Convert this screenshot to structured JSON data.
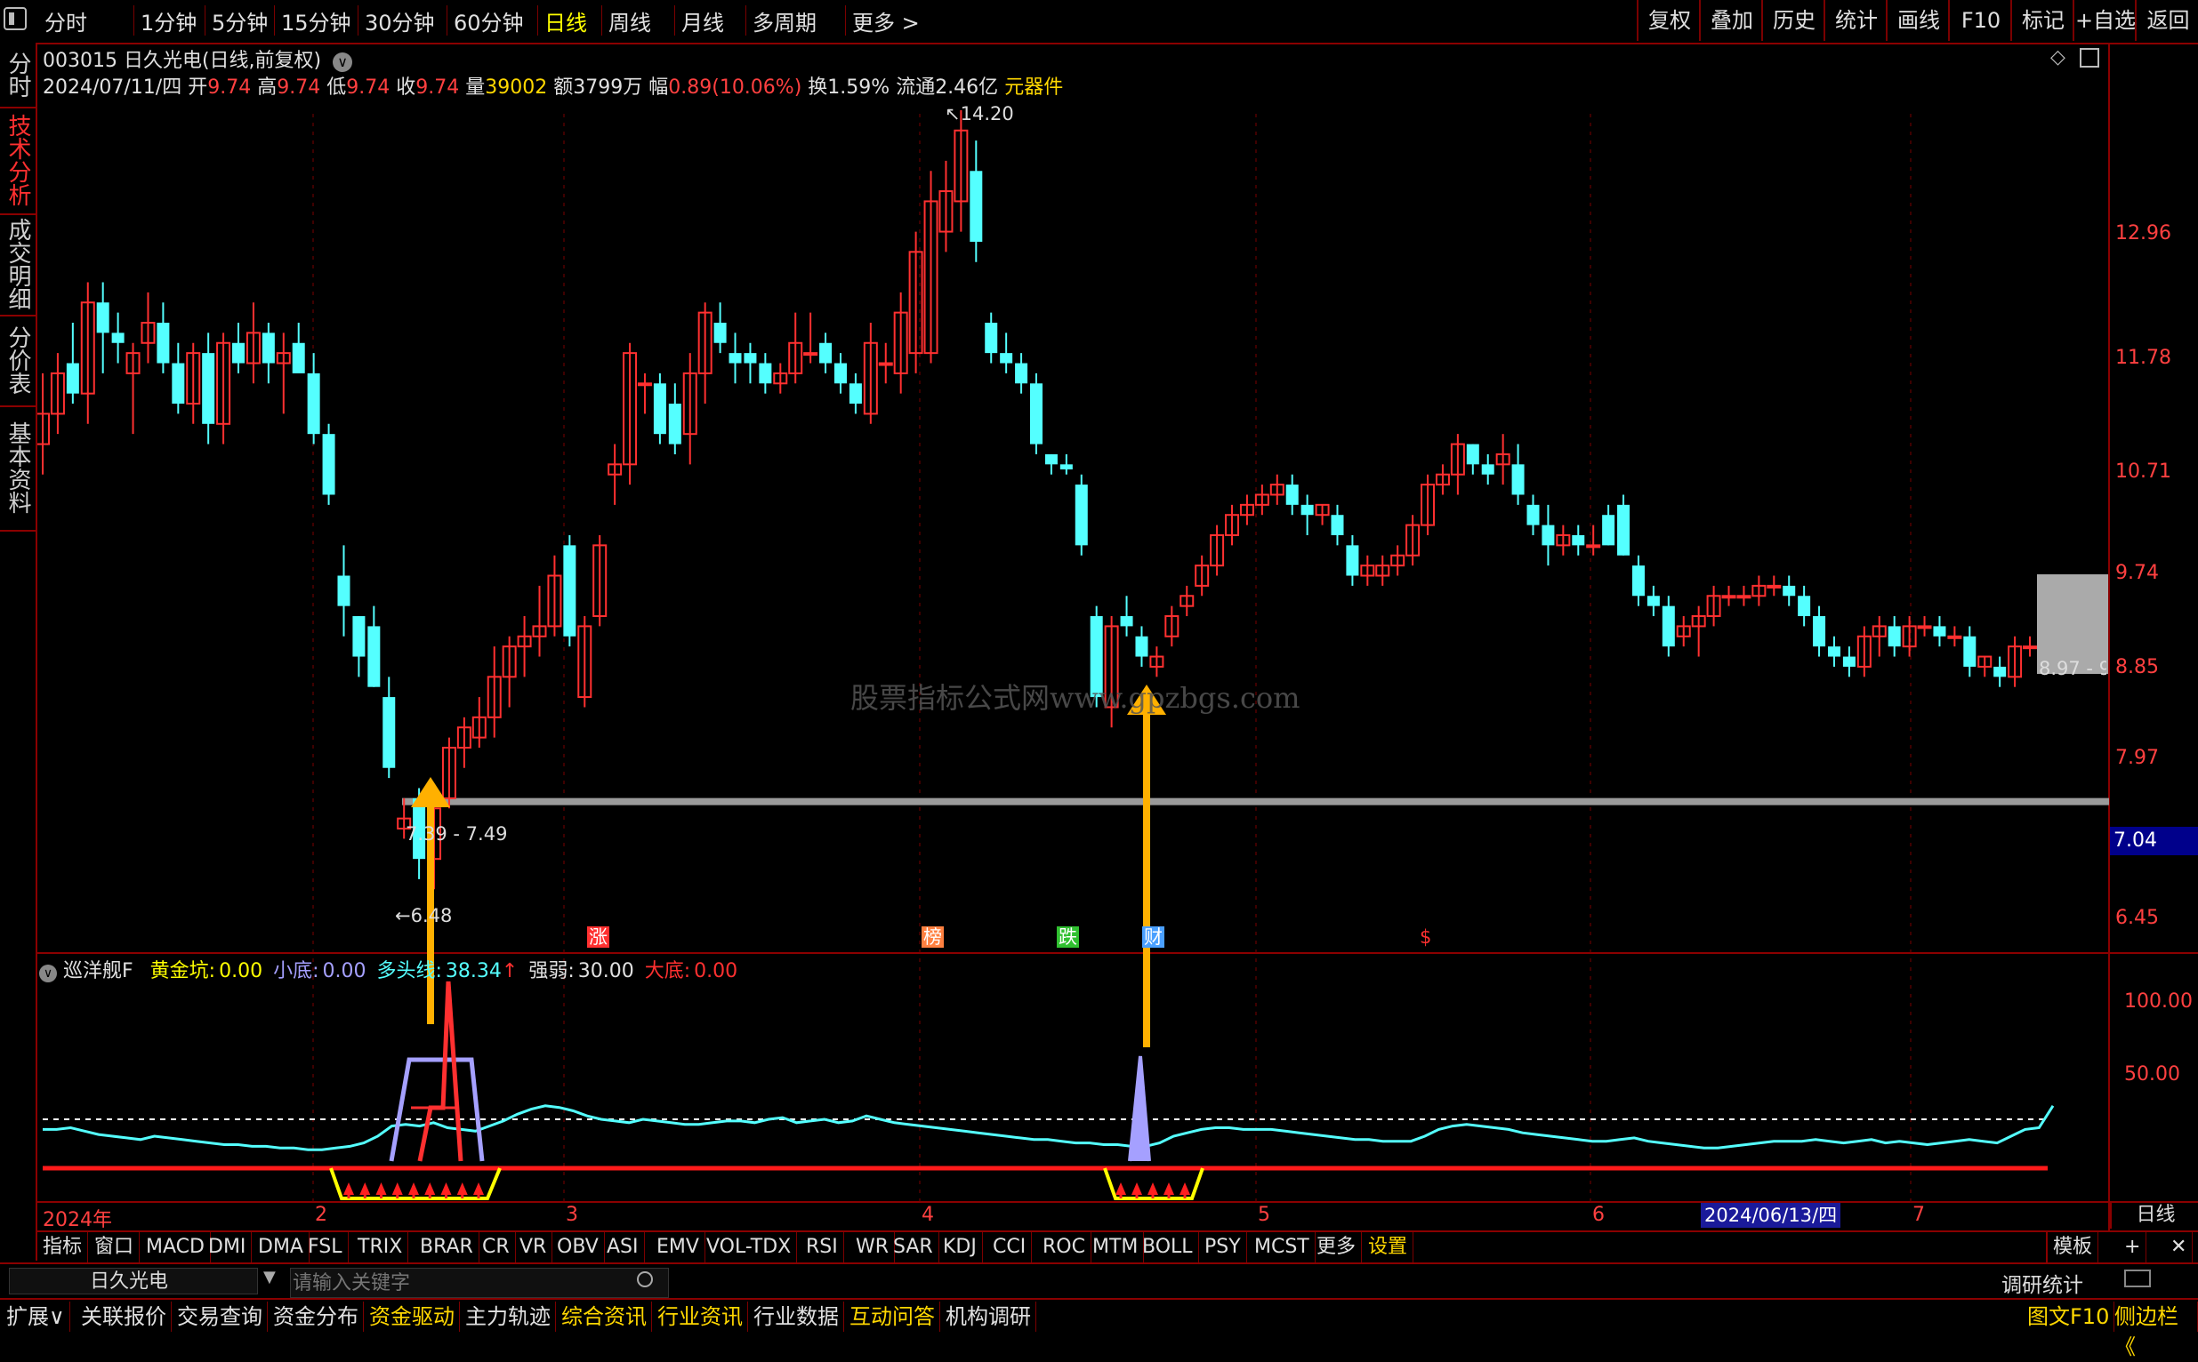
{
  "toolbar": {
    "periods": [
      "分时",
      "1分钟",
      "5分钟",
      "15分钟",
      "30分钟",
      "60分钟",
      "日线",
      "周线",
      "月线",
      "多周期",
      "更多 >"
    ],
    "active_period": "日线",
    "right_buttons": [
      "复权",
      "叠加",
      "历史",
      "统计",
      "画线",
      "F10",
      "标记",
      "+自选",
      "返回"
    ]
  },
  "left_tabs": [
    "分时走势",
    "技术分析",
    "成交明细",
    "分价表",
    "基本资料"
  ],
  "stock": {
    "header": "003015 日久光电(日线,前复权)",
    "date": "2024/07/11/四",
    "open_label": "开",
    "open": "9.74",
    "high_label": "高",
    "high": "9.74",
    "low_label": "低",
    "low": "9.74",
    "close_label": "收",
    "close": "9.74",
    "vol_label": "量",
    "vol": "39002",
    "amount": "额3799万",
    "change_label": "幅",
    "change": "0.89(10.06%)",
    "turnover": "换1.59%",
    "float_cap": "流通2.46亿",
    "sector": "元器件"
  },
  "price_axis": [
    "12.96",
    "11.78",
    "10.71",
    "9.74",
    "8.85",
    "7.97",
    "6.45"
  ],
  "price_tag": "7.04",
  "annotations": {
    "high_mark": "14.20",
    "low_mark": "6.48",
    "range_label": "7.39 - 7.49",
    "right_range_label": "8.97 - 9",
    "watermark": "股票指标公式网www.gpzbgs.com",
    "events": [
      "涨",
      "榜",
      "跌",
      "财",
      "$"
    ]
  },
  "indicator": {
    "name": "巡洋舰F",
    "fields": [
      {
        "label": "黄金坑:",
        "value": "0.00",
        "color": "#ffff00"
      },
      {
        "label": "小底:",
        "value": "0.00",
        "color": "#a5a0ff"
      },
      {
        "label": "多头线:",
        "value": "38.34",
        "color": "#5ff"
      },
      {
        "label": "强弱:",
        "value": "30.00",
        "color": "#e0e0e0"
      },
      {
        "label": "大底:",
        "value": "0.00",
        "color": "#ff3030"
      }
    ],
    "up_arrow": "↑",
    "axis": [
      "100.00",
      "50.00"
    ]
  },
  "time_axis": {
    "labels": [
      "2024年",
      "2",
      "3",
      "4",
      "5",
      "6",
      "7"
    ],
    "highlight": "2024/06/13/四",
    "period_label": "日线"
  },
  "indicator_tabs": [
    "指标",
    "窗口",
    "MACD",
    "DMI",
    "DMA",
    "FSL",
    "TRIX",
    "BRAR",
    "CR",
    "VR",
    "OBV",
    "ASI",
    "EMV",
    "VOL-TDX",
    "RSI",
    "WR",
    "SAR",
    "KDJ",
    "CCI",
    "ROC",
    "MTM",
    "BOLL",
    "PSY",
    "MCST",
    "更多",
    "设置"
  ],
  "template_button": "模板",
  "search": {
    "stock_name": "日久光电",
    "placeholder": "请输入关键字",
    "stats": "调研统计"
  },
  "bottom_tabs": [
    {
      "label": "扩展∨",
      "color": "#e0e0e0"
    },
    {
      "label": "关联报价",
      "color": "#e0e0e0"
    },
    {
      "label": "交易查询",
      "color": "#e0e0e0"
    },
    {
      "label": "资金分布",
      "color": "#e0e0e0"
    },
    {
      "label": "资金驱动",
      "color": "#ffd700"
    },
    {
      "label": "主力轨迹",
      "color": "#e0e0e0"
    },
    {
      "label": "综合资讯",
      "color": "#ffd700"
    },
    {
      "label": "行业资讯",
      "color": "#ffd700"
    },
    {
      "label": "行业数据",
      "color": "#e0e0e0"
    },
    {
      "label": "互动问答",
      "color": "#ffd700"
    },
    {
      "label": "机构调研",
      "color": "#e0e0e0"
    }
  ],
  "bottom_right": [
    "图文F10",
    "侧边栏《"
  ],
  "candles": [
    {
      "o": 10.9,
      "h": 11.6,
      "l": 10.6,
      "c": 11.2
    },
    {
      "o": 11.2,
      "h": 11.8,
      "l": 11.0,
      "c": 11.6
    },
    {
      "o": 11.7,
      "h": 12.1,
      "l": 11.3,
      "c": 11.4
    },
    {
      "o": 11.4,
      "h": 12.5,
      "l": 11.1,
      "c": 12.3
    },
    {
      "o": 12.3,
      "h": 12.5,
      "l": 11.6,
      "c": 12.0
    },
    {
      "o": 12.0,
      "h": 12.2,
      "l": 11.7,
      "c": 11.9
    },
    {
      "o": 11.6,
      "h": 11.9,
      "l": 11.0,
      "c": 11.8
    },
    {
      "o": 11.9,
      "h": 12.4,
      "l": 11.7,
      "c": 12.1
    },
    {
      "o": 12.1,
      "h": 12.3,
      "l": 11.6,
      "c": 11.7
    },
    {
      "o": 11.7,
      "h": 11.9,
      "l": 11.2,
      "c": 11.3
    },
    {
      "o": 11.3,
      "h": 11.9,
      "l": 11.1,
      "c": 11.8
    },
    {
      "o": 11.8,
      "h": 12.0,
      "l": 10.9,
      "c": 11.1
    },
    {
      "o": 11.1,
      "h": 12.0,
      "l": 10.9,
      "c": 11.9
    },
    {
      "o": 11.9,
      "h": 12.1,
      "l": 11.6,
      "c": 11.7
    },
    {
      "o": 11.7,
      "h": 12.3,
      "l": 11.5,
      "c": 12.0
    },
    {
      "o": 12.0,
      "h": 12.1,
      "l": 11.5,
      "c": 11.7
    },
    {
      "o": 11.7,
      "h": 12.0,
      "l": 11.2,
      "c": 11.8
    },
    {
      "o": 11.9,
      "h": 12.1,
      "l": 11.7,
      "c": 11.6
    },
    {
      "o": 11.6,
      "h": 11.8,
      "l": 10.9,
      "c": 11.0
    },
    {
      "o": 11.0,
      "h": 11.1,
      "l": 10.3,
      "c": 10.4
    },
    {
      "o": 9.6,
      "h": 9.9,
      "l": 9.0,
      "c": 9.3
    },
    {
      "o": 9.2,
      "h": 9.2,
      "l": 8.6,
      "c": 8.8
    },
    {
      "o": 9.1,
      "h": 9.3,
      "l": 8.5,
      "c": 8.5
    },
    {
      "o": 8.4,
      "h": 8.6,
      "l": 7.6,
      "c": 7.7
    },
    {
      "o": 7.1,
      "h": 7.4,
      "l": 7.0,
      "c": 7.2
    },
    {
      "o": 7.4,
      "h": 7.5,
      "l": 6.6,
      "c": 6.8
    },
    {
      "o": 6.8,
      "h": 7.4,
      "l": 6.5,
      "c": 7.3
    },
    {
      "o": 7.4,
      "h": 8.0,
      "l": 7.3,
      "c": 7.9
    },
    {
      "o": 7.9,
      "h": 8.2,
      "l": 7.7,
      "c": 8.1
    },
    {
      "o": 8.0,
      "h": 8.4,
      "l": 7.9,
      "c": 8.2
    },
    {
      "o": 8.2,
      "h": 8.9,
      "l": 8.0,
      "c": 8.6
    },
    {
      "o": 8.6,
      "h": 9.0,
      "l": 8.3,
      "c": 8.9
    },
    {
      "o": 8.9,
      "h": 9.2,
      "l": 8.6,
      "c": 9.0
    },
    {
      "o": 9.0,
      "h": 9.5,
      "l": 8.8,
      "c": 9.1
    },
    {
      "o": 9.1,
      "h": 9.8,
      "l": 9.0,
      "c": 9.6
    },
    {
      "o": 9.9,
      "h": 10.0,
      "l": 8.9,
      "c": 9.0
    },
    {
      "o": 8.4,
      "h": 9.2,
      "l": 8.3,
      "c": 9.1
    },
    {
      "o": 9.2,
      "h": 10.0,
      "l": 9.1,
      "c": 9.9
    },
    {
      "o": 10.6,
      "h": 10.9,
      "l": 10.3,
      "c": 10.7
    },
    {
      "o": 10.7,
      "h": 11.9,
      "l": 10.5,
      "c": 11.8
    },
    {
      "o": 11.5,
      "h": 11.6,
      "l": 11.2,
      "c": 11.5
    },
    {
      "o": 11.5,
      "h": 11.6,
      "l": 10.9,
      "c": 11.0
    },
    {
      "o": 11.3,
      "h": 11.5,
      "l": 10.8,
      "c": 10.9
    },
    {
      "o": 11.0,
      "h": 11.8,
      "l": 10.7,
      "c": 11.6
    },
    {
      "o": 11.6,
      "h": 12.3,
      "l": 11.3,
      "c": 12.2
    },
    {
      "o": 12.1,
      "h": 12.3,
      "l": 11.8,
      "c": 11.9
    },
    {
      "o": 11.8,
      "h": 12.0,
      "l": 11.5,
      "c": 11.7
    },
    {
      "o": 11.8,
      "h": 11.9,
      "l": 11.5,
      "c": 11.7
    },
    {
      "o": 11.7,
      "h": 11.8,
      "l": 11.4,
      "c": 11.5
    },
    {
      "o": 11.5,
      "h": 11.7,
      "l": 11.4,
      "c": 11.6
    },
    {
      "o": 11.6,
      "h": 12.2,
      "l": 11.5,
      "c": 11.9
    },
    {
      "o": 11.8,
      "h": 12.2,
      "l": 11.7,
      "c": 11.8
    },
    {
      "o": 11.9,
      "h": 12.0,
      "l": 11.6,
      "c": 11.7
    },
    {
      "o": 11.7,
      "h": 11.8,
      "l": 11.4,
      "c": 11.5
    },
    {
      "o": 11.5,
      "h": 11.6,
      "l": 11.2,
      "c": 11.3
    },
    {
      "o": 11.2,
      "h": 12.1,
      "l": 11.1,
      "c": 11.9
    },
    {
      "o": 11.7,
      "h": 11.9,
      "l": 11.5,
      "c": 11.7
    },
    {
      "o": 11.6,
      "h": 12.4,
      "l": 11.4,
      "c": 12.2
    },
    {
      "o": 11.8,
      "h": 13.0,
      "l": 11.6,
      "c": 12.8
    },
    {
      "o": 11.8,
      "h": 13.6,
      "l": 11.7,
      "c": 13.3
    },
    {
      "o": 13.0,
      "h": 13.7,
      "l": 12.8,
      "c": 13.4
    },
    {
      "o": 13.3,
      "h": 14.2,
      "l": 13.0,
      "c": 14.0
    },
    {
      "o": 13.6,
      "h": 13.9,
      "l": 12.7,
      "c": 12.9
    },
    {
      "o": 12.1,
      "h": 12.2,
      "l": 11.7,
      "c": 11.8
    },
    {
      "o": 11.8,
      "h": 12.0,
      "l": 11.6,
      "c": 11.7
    },
    {
      "o": 11.7,
      "h": 11.8,
      "l": 11.4,
      "c": 11.5
    },
    {
      "o": 11.5,
      "h": 11.6,
      "l": 10.8,
      "c": 10.9
    },
    {
      "o": 10.8,
      "h": 10.8,
      "l": 10.6,
      "c": 10.7
    },
    {
      "o": 10.7,
      "h": 10.8,
      "l": 10.6,
      "c": 10.65
    },
    {
      "o": 10.5,
      "h": 10.6,
      "l": 9.8,
      "c": 9.9
    },
    {
      "o": 9.2,
      "h": 9.3,
      "l": 8.3,
      "c": 8.4
    },
    {
      "o": 8.3,
      "h": 9.2,
      "l": 8.1,
      "c": 9.1
    },
    {
      "o": 9.2,
      "h": 9.4,
      "l": 9.0,
      "c": 9.1
    },
    {
      "o": 9.0,
      "h": 9.1,
      "l": 8.7,
      "c": 8.8
    },
    {
      "o": 8.7,
      "h": 8.9,
      "l": 8.6,
      "c": 8.8
    },
    {
      "o": 9.0,
      "h": 9.3,
      "l": 8.9,
      "c": 9.2
    },
    {
      "o": 9.3,
      "h": 9.5,
      "l": 9.2,
      "c": 9.4
    },
    {
      "o": 9.5,
      "h": 9.8,
      "l": 9.4,
      "c": 9.7
    },
    {
      "o": 9.7,
      "h": 10.1,
      "l": 9.6,
      "c": 10.0
    },
    {
      "o": 10.0,
      "h": 10.3,
      "l": 9.9,
      "c": 10.2
    },
    {
      "o": 10.2,
      "h": 10.4,
      "l": 10.1,
      "c": 10.3
    },
    {
      "o": 10.3,
      "h": 10.5,
      "l": 10.2,
      "c": 10.4
    },
    {
      "o": 10.4,
      "h": 10.6,
      "l": 10.3,
      "c": 10.5
    },
    {
      "o": 10.5,
      "h": 10.6,
      "l": 10.2,
      "c": 10.3
    },
    {
      "o": 10.3,
      "h": 10.4,
      "l": 10.0,
      "c": 10.2
    },
    {
      "o": 10.2,
      "h": 10.3,
      "l": 10.1,
      "c": 10.3
    },
    {
      "o": 10.2,
      "h": 10.3,
      "l": 9.9,
      "c": 10.0
    },
    {
      "o": 9.9,
      "h": 10.0,
      "l": 9.5,
      "c": 9.6
    },
    {
      "o": 9.6,
      "h": 9.8,
      "l": 9.5,
      "c": 9.7
    },
    {
      "o": 9.6,
      "h": 9.8,
      "l": 9.5,
      "c": 9.7
    },
    {
      "o": 9.7,
      "h": 9.9,
      "l": 9.6,
      "c": 9.8
    },
    {
      "o": 9.8,
      "h": 10.2,
      "l": 9.7,
      "c": 10.1
    },
    {
      "o": 10.1,
      "h": 10.6,
      "l": 10.0,
      "c": 10.5
    },
    {
      "o": 10.5,
      "h": 10.7,
      "l": 10.4,
      "c": 10.6
    },
    {
      "o": 10.6,
      "h": 11.0,
      "l": 10.4,
      "c": 10.9
    },
    {
      "o": 10.9,
      "h": 10.9,
      "l": 10.6,
      "c": 10.7
    },
    {
      "o": 10.7,
      "h": 10.8,
      "l": 10.5,
      "c": 10.6
    },
    {
      "o": 10.7,
      "h": 11.0,
      "l": 10.5,
      "c": 10.8
    },
    {
      "o": 10.7,
      "h": 10.9,
      "l": 10.3,
      "c": 10.4
    },
    {
      "o": 10.3,
      "h": 10.4,
      "l": 10.0,
      "c": 10.1
    },
    {
      "o": 10.1,
      "h": 10.3,
      "l": 9.7,
      "c": 9.9
    },
    {
      "o": 9.9,
      "h": 10.1,
      "l": 9.8,
      "c": 10.0
    },
    {
      "o": 10.0,
      "h": 10.1,
      "l": 9.8,
      "c": 9.9
    },
    {
      "o": 9.9,
      "h": 10.1,
      "l": 9.8,
      "c": 9.9
    },
    {
      "o": 10.2,
      "h": 10.3,
      "l": 9.9,
      "c": 9.9
    },
    {
      "o": 10.3,
      "h": 10.4,
      "l": 9.8,
      "c": 9.8
    },
    {
      "o": 9.7,
      "h": 9.8,
      "l": 9.3,
      "c": 9.4
    },
    {
      "o": 9.4,
      "h": 9.5,
      "l": 9.2,
      "c": 9.3
    },
    {
      "o": 9.3,
      "h": 9.4,
      "l": 8.8,
      "c": 8.9
    },
    {
      "o": 9.0,
      "h": 9.2,
      "l": 8.9,
      "c": 9.1
    },
    {
      "o": 9.1,
      "h": 9.3,
      "l": 8.8,
      "c": 9.2
    },
    {
      "o": 9.2,
      "h": 9.5,
      "l": 9.1,
      "c": 9.4
    },
    {
      "o": 9.4,
      "h": 9.5,
      "l": 9.3,
      "c": 9.4
    },
    {
      "o": 9.4,
      "h": 9.5,
      "l": 9.3,
      "c": 9.4
    },
    {
      "o": 9.4,
      "h": 9.6,
      "l": 9.3,
      "c": 9.5
    },
    {
      "o": 9.5,
      "h": 9.6,
      "l": 9.4,
      "c": 9.5
    },
    {
      "o": 9.5,
      "h": 9.6,
      "l": 9.3,
      "c": 9.4
    },
    {
      "o": 9.4,
      "h": 9.5,
      "l": 9.1,
      "c": 9.2
    },
    {
      "o": 9.2,
      "h": 9.3,
      "l": 8.8,
      "c": 8.9
    },
    {
      "o": 8.9,
      "h": 9.0,
      "l": 8.7,
      "c": 8.8
    },
    {
      "o": 8.8,
      "h": 8.9,
      "l": 8.6,
      "c": 8.7
    },
    {
      "o": 8.7,
      "h": 9.1,
      "l": 8.6,
      "c": 9.0
    },
    {
      "o": 9.0,
      "h": 9.2,
      "l": 8.8,
      "c": 9.1
    },
    {
      "o": 9.1,
      "h": 9.2,
      "l": 8.8,
      "c": 8.9
    },
    {
      "o": 8.9,
      "h": 9.2,
      "l": 8.8,
      "c": 9.1
    },
    {
      "o": 9.1,
      "h": 9.2,
      "l": 9.0,
      "c": 9.1
    },
    {
      "o": 9.1,
      "h": 9.2,
      "l": 8.9,
      "c": 9.0
    },
    {
      "o": 9.0,
      "h": 9.1,
      "l": 8.9,
      "c": 9.0
    },
    {
      "o": 9.0,
      "h": 9.1,
      "l": 8.6,
      "c": 8.7
    },
    {
      "o": 8.7,
      "h": 8.8,
      "l": 8.6,
      "c": 8.8
    },
    {
      "o": 8.7,
      "h": 8.8,
      "l": 8.5,
      "c": 8.6
    },
    {
      "o": 8.6,
      "h": 9.0,
      "l": 8.5,
      "c": 8.9
    },
    {
      "o": 8.9,
      "h": 9.0,
      "l": 8.8,
      "c": 8.9
    }
  ]
}
